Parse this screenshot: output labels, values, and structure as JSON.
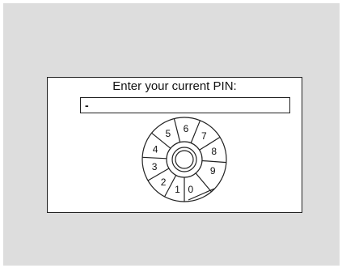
{
  "dialog": {
    "prompt": "Enter your current PIN:",
    "pin_value": "-"
  },
  "dial": {
    "digits": [
      "0",
      "1",
      "2",
      "3",
      "4",
      "5",
      "6",
      "7",
      "8",
      "9"
    ]
  },
  "colors": {
    "background": "#dddddd",
    "panel": "#ffffff",
    "ink": "#222222"
  }
}
